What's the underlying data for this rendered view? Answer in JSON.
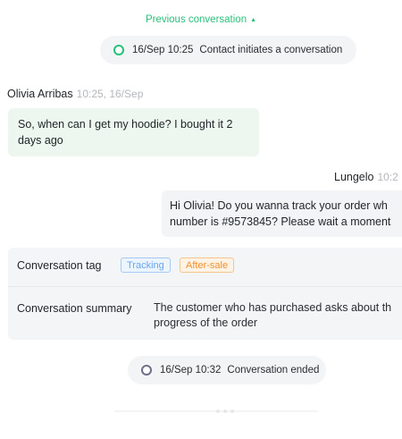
{
  "history": {
    "previous_label": "Previous conversation",
    "previous_icon": "triangle-up-icon"
  },
  "system_events": {
    "start": {
      "time": "16/Sep 10:25",
      "text": "Contact initiates a conversation",
      "dot_color": "#25c07a"
    },
    "end": {
      "time": "16/Sep 10:32",
      "text": "Conversation ended",
      "dot_color": "#6e6e8a"
    }
  },
  "messages": [
    {
      "sender": "Olivia Arribas",
      "time": "10:25, 16/Sep",
      "text": "So, when can I get my hoodie? I bought it 2 days ago",
      "side": "left"
    },
    {
      "sender": "Lungelo",
      "time": "10:2",
      "line1": "Hi Olivia! Do you wanna track your order wh",
      "line2": "number is #9573845? Please wait a moment",
      "side": "right"
    }
  ],
  "info": {
    "tag_label": "Conversation tag",
    "tags": [
      "Tracking",
      "After-sale"
    ],
    "summary_label": "Conversation summary",
    "summary_line1": "The customer who has purchased asks about th",
    "summary_line2": "progress of the order"
  },
  "colors": {
    "accent_green": "#2bbf7a",
    "customer_bubble": "#edf7ef",
    "agent_bubble": "#f3f4f5",
    "tag_tracking": "#6aa6ee",
    "tag_aftersale": "#f0902c"
  }
}
